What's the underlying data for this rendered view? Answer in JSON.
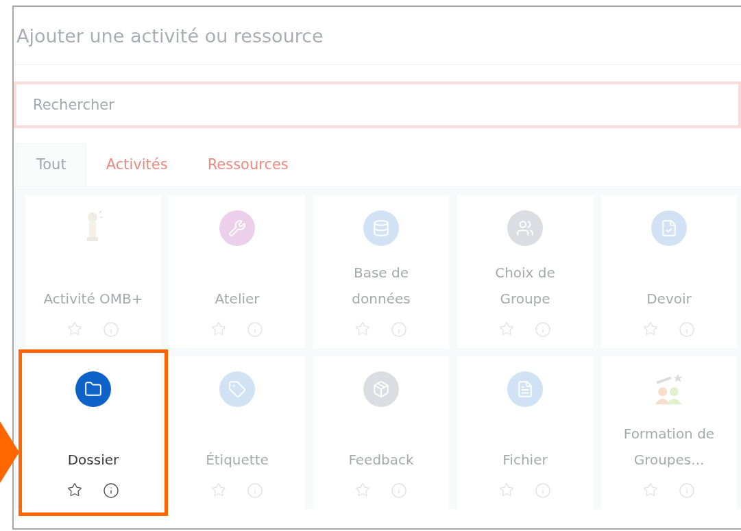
{
  "dialog": {
    "title": "Ajouter une activité ou ressource"
  },
  "search": {
    "placeholder": "Rechercher"
  },
  "tabs": [
    {
      "label": "Tout",
      "selected": true
    },
    {
      "label": "Activités",
      "selected": false
    },
    {
      "label": "Ressources",
      "selected": false
    }
  ],
  "items": [
    {
      "name": "Activité OMB+",
      "kind": "figure",
      "highlighted": false
    },
    {
      "name": "Atelier",
      "kind": "tools",
      "color": "#e9c8e8",
      "highlighted": false
    },
    {
      "name": "Base de données",
      "kind": "database",
      "color": "#c9def4",
      "highlighted": false
    },
    {
      "name": "Choix de Groupe",
      "kind": "group",
      "color": "#d6d6df",
      "highlighted": false
    },
    {
      "name": "Devoir",
      "kind": "assignment",
      "color": "#c9def4",
      "highlighted": false
    },
    {
      "name": "Dossier",
      "kind": "folder",
      "color": "#0f62c8",
      "highlighted": true
    },
    {
      "name": "Étiquette",
      "kind": "tag",
      "color": "#c9def4",
      "highlighted": false
    },
    {
      "name": "Feedback",
      "kind": "box",
      "color": "#d6d6df",
      "highlighted": false
    },
    {
      "name": "Fichier",
      "kind": "file",
      "color": "#c9def4",
      "highlighted": false
    },
    {
      "name": "Formation de Groupes...",
      "kind": "people",
      "highlighted": false
    }
  ]
}
